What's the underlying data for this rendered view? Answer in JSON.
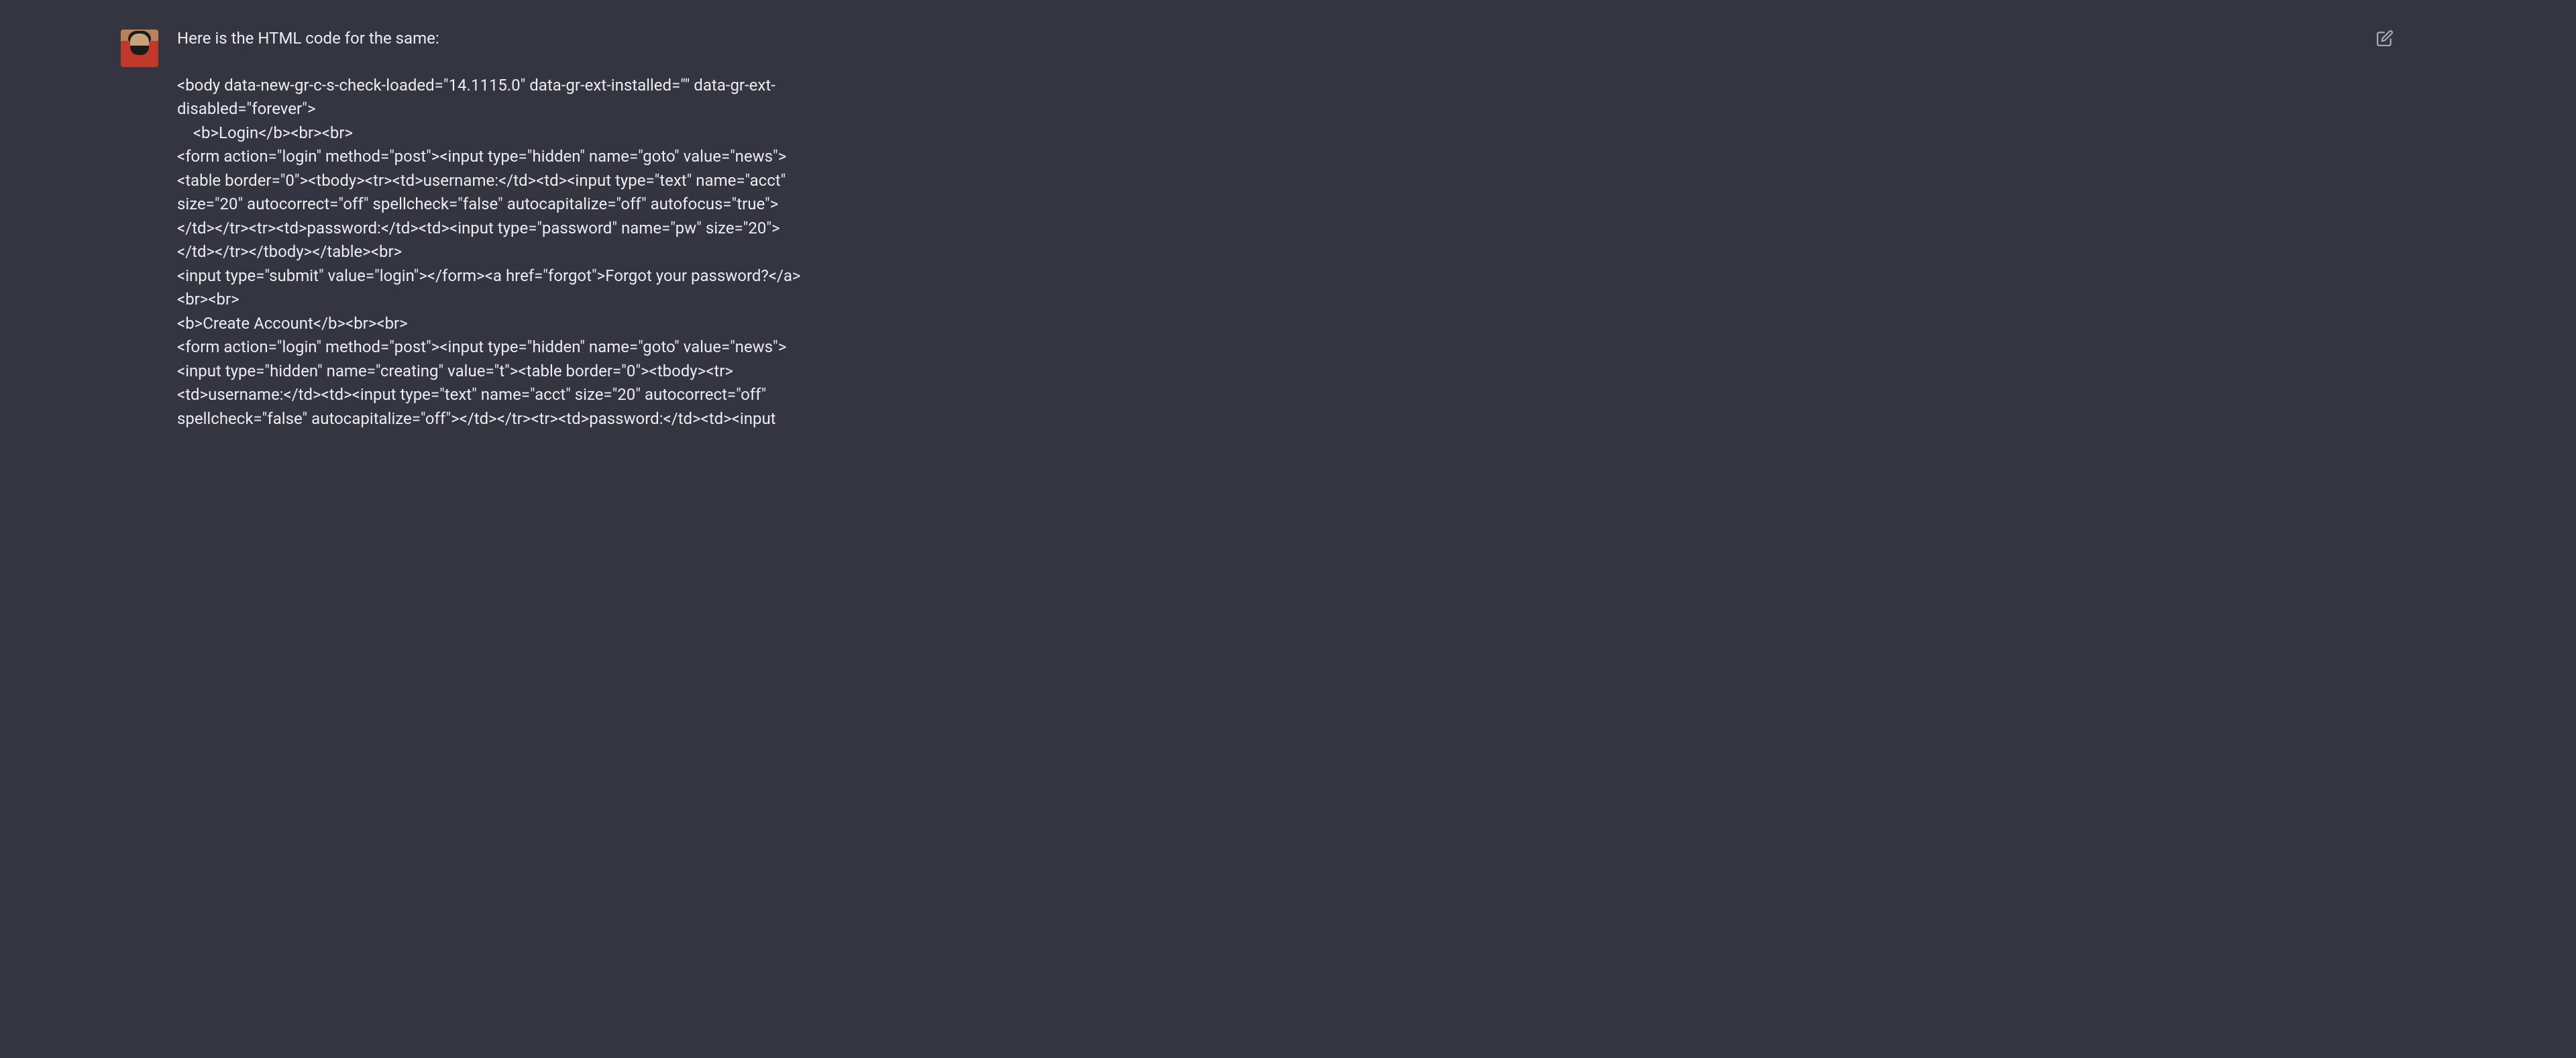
{
  "message": {
    "intro": "Here is the HTML code for the same:",
    "code_lines": [
      "<body data-new-gr-c-s-check-loaded=\"14.1115.0\" data-gr-ext-installed=\"\" data-gr-ext-disabled=\"forever\">",
      "    <b>Login</b><br><br>",
      "<form action=\"login\" method=\"post\"><input type=\"hidden\" name=\"goto\" value=\"news\">",
      "<table border=\"0\"><tbody><tr><td>username:</td><td><input type=\"text\" name=\"acct\" size=\"20\" autocorrect=\"off\" spellcheck=\"false\" autocapitalize=\"off\" autofocus=\"true\"></td></tr><tr><td>password:</td><td><input type=\"password\" name=\"pw\" size=\"20\"></td></tr></tbody></table><br>",
      "<input type=\"submit\" value=\"login\"></form><a href=\"forgot\">Forgot your password?</a><br><br>",
      "<b>Create Account</b><br><br>",
      "<form action=\"login\" method=\"post\"><input type=\"hidden\" name=\"goto\" value=\"news\">",
      "<input type=\"hidden\" name=\"creating\" value=\"t\"><table border=\"0\"><tbody><tr><td>username:</td><td><input type=\"text\" name=\"acct\" size=\"20\" autocorrect=\"off\" spellcheck=\"false\" autocapitalize=\"off\"></td></tr><tr><td>password:</td><td><input"
    ]
  },
  "icons": {
    "edit": "edit-icon"
  }
}
